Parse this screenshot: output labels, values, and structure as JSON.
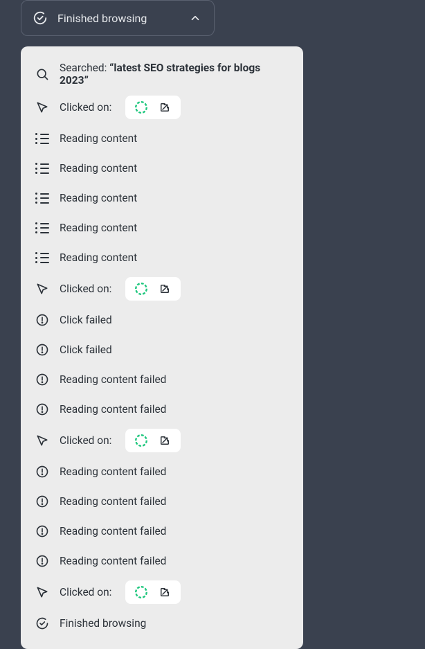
{
  "header": {
    "title": "Finished browsing"
  },
  "log": {
    "search": {
      "prefix": "Searched: ",
      "query": "“latest SEO strategies for blogs 2023”"
    },
    "clicked_label": "Clicked on:",
    "reading_label": "Reading content",
    "click_failed_label": "Click failed",
    "reading_failed_label": "Reading content failed",
    "finished_label": "Finished browsing"
  },
  "colors": {
    "favicon": "#1fc77e"
  }
}
